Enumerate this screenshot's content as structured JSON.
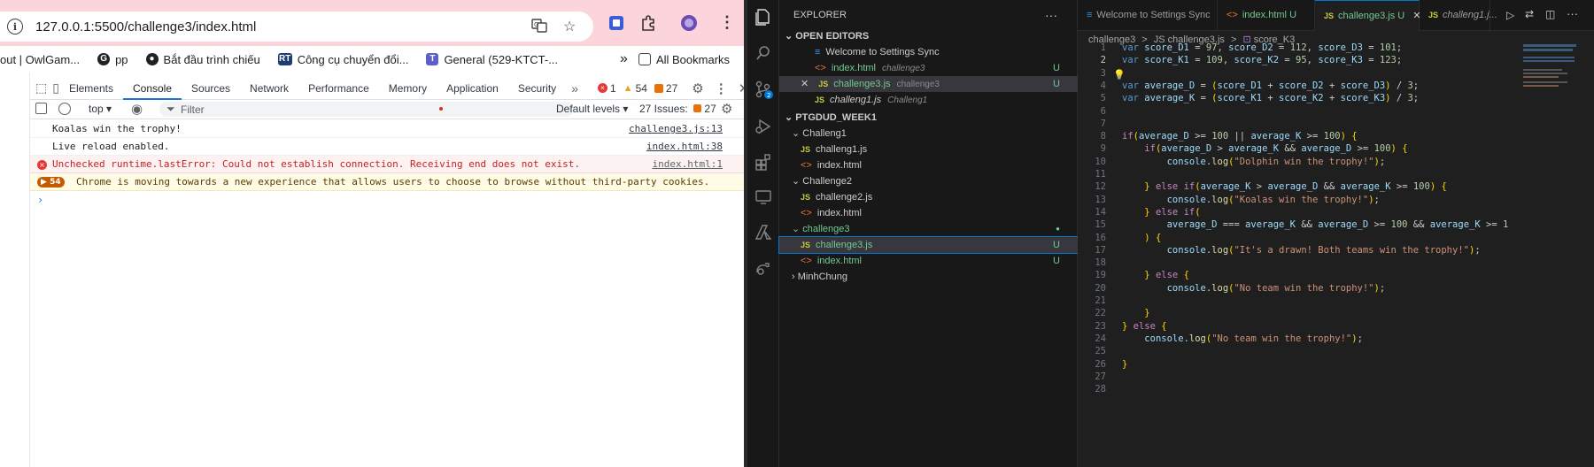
{
  "browser": {
    "url": "127.0.0.1:5500/challenge3/index.html",
    "bookmarks": [
      {
        "label": "out | OwlGam...",
        "icon": "owl-icon",
        "color": "#f0a23b"
      },
      {
        "label": "pp",
        "icon": "g-icon",
        "color": "#4285f4"
      },
      {
        "label": "Bắt đầu trình chiếu",
        "icon": "slides-icon",
        "color": "#202124"
      },
      {
        "label": "Công cụ chuyển đổi...",
        "icon": "rt-icon",
        "color": "#1f3b73"
      },
      {
        "label": "General (529-KTCT-...",
        "icon": "teams-icon",
        "color": "#5b5fc7"
      }
    ],
    "all_bookmarks": "All Bookmarks",
    "overflow": "»"
  },
  "devtools": {
    "tabs": [
      "Elements",
      "Console",
      "Sources",
      "Network",
      "Performance",
      "Memory",
      "Application",
      "Security"
    ],
    "active_tab": "Console",
    "more_tabs": "»",
    "error_count": "1",
    "warning_count": "54",
    "issue_count": "27",
    "context": "top",
    "filter_placeholder": "Filter",
    "levels": "Default levels",
    "issues_label": "27 Issues:",
    "issues_badge": "27",
    "messages": [
      {
        "text": "Koalas win the trophy!",
        "source": "challenge3.js:13",
        "level": "log"
      },
      {
        "text": "Live reload enabled.",
        "source": "index.html:38",
        "level": "log"
      },
      {
        "text": "Unchecked runtime.lastError: Could not establish connection. Receiving end does not exist.",
        "source": "index.html:1",
        "level": "error"
      },
      {
        "text": "Chrome is moving towards a new experience that allows users to choose to browse without third-party cookies.",
        "source": "",
        "level": "warning",
        "badge": "54"
      }
    ],
    "prompt": "›"
  },
  "vscode": {
    "explorer_title": "EXPLORER",
    "open_editors_label": "OPEN EDITORS",
    "open_editors": [
      {
        "name": "Welcome to Settings Sync",
        "folder": "",
        "status": "",
        "icon": "vscode-icon"
      },
      {
        "name": "index.html",
        "folder": "challenge3",
        "status": "U",
        "icon": "html-icon"
      },
      {
        "name": "challenge3.js",
        "folder": "challenge3",
        "status": "U",
        "icon": "js-icon",
        "active": true
      },
      {
        "name": "challeng1.js",
        "folder": "Challeng1",
        "status": "",
        "icon": "js-icon"
      }
    ],
    "workspace_label": "PTGDUD_WEEK1",
    "tree": [
      {
        "name": "Challeng1",
        "type": "folder",
        "depth": 1
      },
      {
        "name": "challeng1.js",
        "type": "js",
        "depth": 2
      },
      {
        "name": "index.html",
        "type": "html",
        "depth": 2
      },
      {
        "name": "Challenge2",
        "type": "folder",
        "depth": 1
      },
      {
        "name": "challenge2.js",
        "type": "js",
        "depth": 2
      },
      {
        "name": "index.html",
        "type": "html",
        "depth": 2
      },
      {
        "name": "challenge3",
        "type": "folder",
        "depth": 1,
        "status": "●"
      },
      {
        "name": "challenge3.js",
        "type": "js",
        "depth": 2,
        "status": "U",
        "selected": true
      },
      {
        "name": "index.html",
        "type": "html",
        "depth": 2,
        "status": "U"
      },
      {
        "name": "MinhChung",
        "type": "folder-collapsed",
        "depth": 1
      }
    ],
    "tabs": [
      {
        "label": "Welcome to Settings Sync",
        "icon": "vscode-icon",
        "status": ""
      },
      {
        "label": "index.html",
        "icon": "html-icon",
        "status": "U"
      },
      {
        "label": "challenge3.js",
        "icon": "js-icon",
        "status": "U",
        "active": true
      },
      {
        "label": "challeng1.j...",
        "icon": "js-icon",
        "status": ""
      }
    ],
    "breadcrumb": [
      "challenge3",
      ">",
      "JS challenge3.js",
      ">",
      "score_K3"
    ],
    "line_numbers": [
      "1",
      "2",
      "3",
      "4",
      "5",
      "6",
      "7",
      "8",
      "9",
      "10",
      "11",
      "12",
      "13",
      "14",
      "15",
      "16",
      "17",
      "18",
      "19",
      "20",
      "21",
      "22",
      "23",
      "24",
      "25",
      "26",
      "27",
      "28"
    ],
    "code": [
      "var score_D1 = 97, score_D2 = 112, score_D3 = 101;",
      "var score_K1 = 109, score_K2 = 95, score_K3 = 123;",
      "",
      "var average_D = (score_D1 + score_D2 + score_D3) / 3;",
      "var average_K = (score_K1 + score_K2 + score_K3) / 3;",
      "",
      "",
      "if(average_D >= 100 || average_K >= 100) {",
      "    if(average_D > average_K && average_D >= 100) {",
      "        console.log(\"Dolphin win the trophy!\");",
      "",
      "    } else if(average_K > average_D && average_K >= 100) {",
      "        console.log(\"Koalas win the trophy!\");",
      "    } else if(",
      "        average_D === average_K && average_D >= 100 && average_K >= 1",
      "    ) {",
      "        console.log(\"It's a drawn! Both teams win the trophy!\");",
      "",
      "    } else {",
      "        console.log(\"No team win the trophy!\");",
      "",
      "    }",
      "} else {",
      "    console.log(\"No team win the trophy!\");",
      "",
      "}",
      "",
      ""
    ]
  }
}
